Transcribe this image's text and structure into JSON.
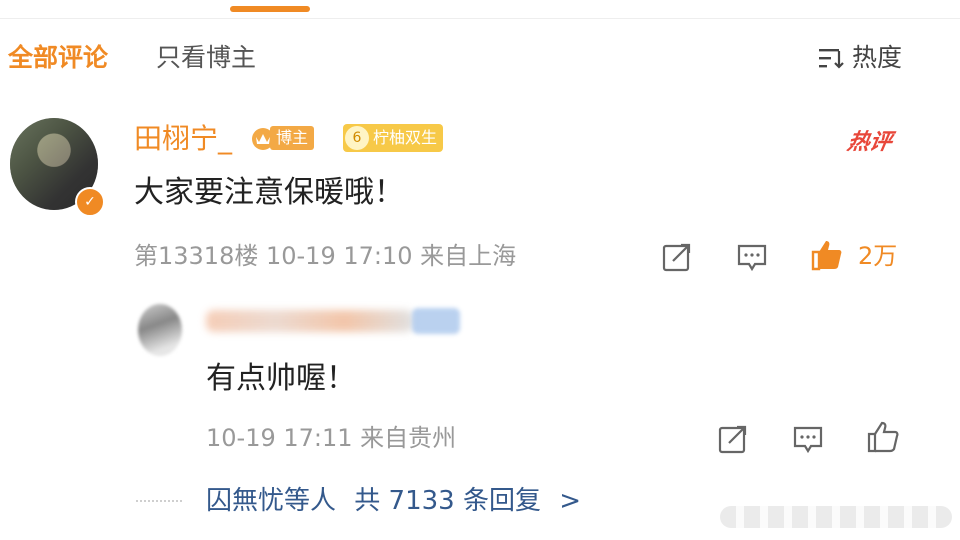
{
  "tabs": {
    "active_label": "全部评论",
    "inactive_label": "只看博主",
    "sort_label": "热度"
  },
  "comment": {
    "username": "田栩宁_",
    "badge_blogger": "博主",
    "badge_fan_level": "6",
    "badge_fan": "柠柚双生",
    "hot_label": "热评",
    "text": "大家要注意保暖哦！",
    "meta": "第13318楼 10-19 17:10 来自上海",
    "likes": "2万"
  },
  "reply": {
    "text": "有点帅喔！",
    "meta": "10-19 17:11 来自贵州"
  },
  "more_replies": {
    "prefix": "囚無忧等人",
    "count": "共 7133 条回复",
    "arrow": ">"
  },
  "colors": {
    "accent": "#f08a24",
    "link": "#34598c",
    "meta": "#999999",
    "hot": "#e8473a"
  }
}
